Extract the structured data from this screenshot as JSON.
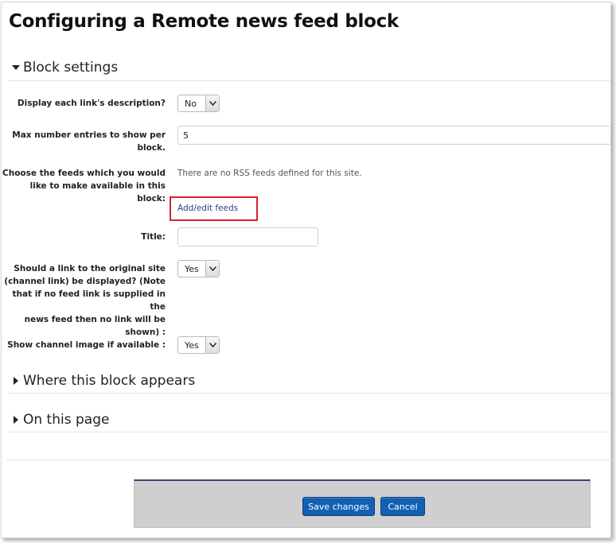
{
  "page": {
    "title": "Configuring a Remote news feed block"
  },
  "sections": {
    "block_settings": "Block settings",
    "where_appears": "Where this block appears",
    "on_this_page": "On this page"
  },
  "form": {
    "display_description": {
      "label": "Display each link's description?",
      "value": "No"
    },
    "max_entries": {
      "label_line1": "Max number entries to show per",
      "label_line2": "block.",
      "value": "5"
    },
    "choose_feeds": {
      "label_line1": "Choose the feeds which you would",
      "label_line2": "like to make available in this block:",
      "message": "There are no RSS feeds defined for this site.",
      "link": "Add/edit feeds"
    },
    "title": {
      "label": "Title:",
      "value": ""
    },
    "channel_link": {
      "label_lines": [
        "Should a link to the original site",
        "(channel link) be displayed? (Note",
        "that if no feed link is supplied in the",
        "news feed then no link will be",
        "shown) :"
      ],
      "value": "Yes"
    },
    "channel_image": {
      "label": "Show channel image if available :",
      "value": "Yes"
    }
  },
  "buttons": {
    "save": "Save changes",
    "cancel": "Cancel"
  },
  "colors": {
    "button": "#1160b4",
    "highlight_box": "#d9202c",
    "link": "#2d3a8c"
  }
}
